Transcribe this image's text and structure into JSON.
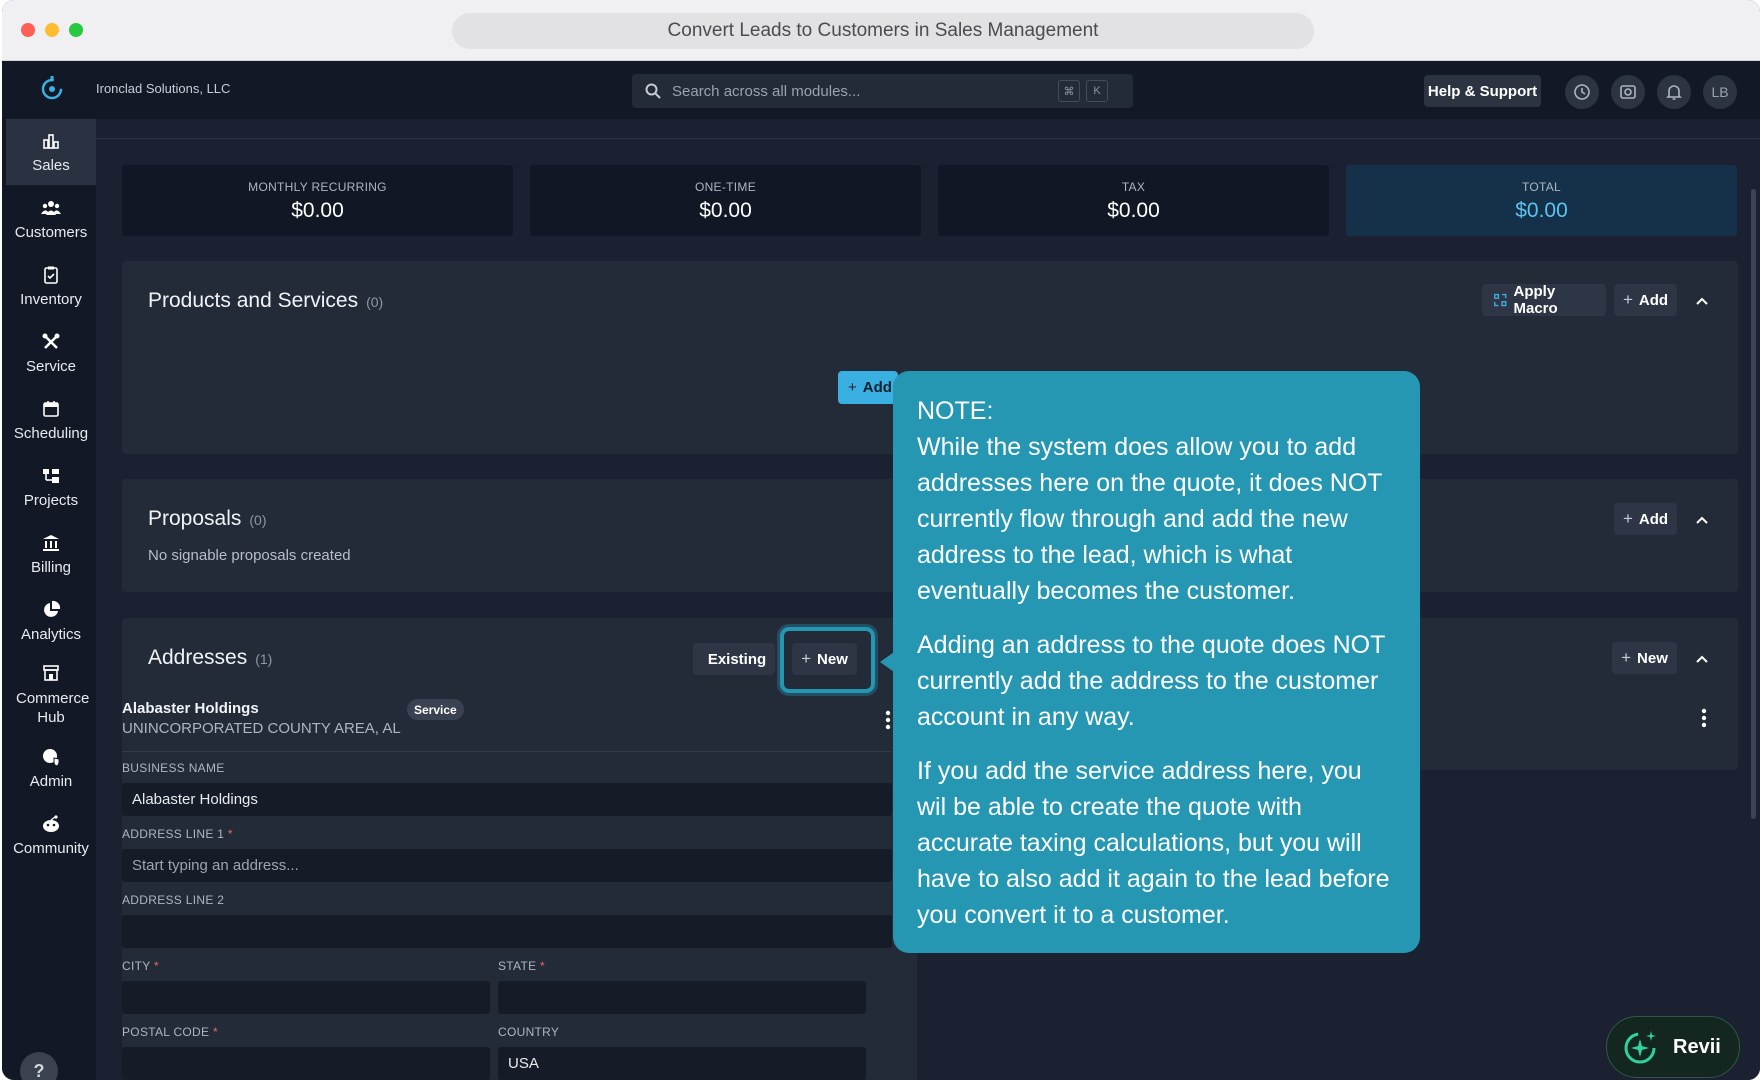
{
  "window": {
    "title": "Convert Leads to Customers in Sales Management"
  },
  "appbar": {
    "company": "Ironclad Solutions, LLC",
    "search_placeholder": "Search across all modules...",
    "kbd1": "⌘",
    "kbd2": "K",
    "help_label": "Help & Support",
    "avatar_initials": "LB"
  },
  "sidebar": {
    "items": [
      {
        "label": "Sales",
        "icon": "bar-chart-icon",
        "active": true
      },
      {
        "label": "Customers",
        "icon": "users-icon"
      },
      {
        "label": "Inventory",
        "icon": "clipboard-icon"
      },
      {
        "label": "Service",
        "icon": "tools-icon"
      },
      {
        "label": "Scheduling",
        "icon": "calendar-icon"
      },
      {
        "label": "Projects",
        "icon": "projects-icon"
      },
      {
        "label": "Billing",
        "icon": "bank-icon"
      },
      {
        "label": "Analytics",
        "icon": "pie-chart-icon"
      },
      {
        "label": "Commerce Hub",
        "icon": "store-icon"
      },
      {
        "label": "Admin",
        "icon": "admin-shield-icon"
      },
      {
        "label": "Community",
        "icon": "community-icon"
      }
    ],
    "help": "?"
  },
  "stats": [
    {
      "label": "MONTHLY RECURRING",
      "value": "$0.00"
    },
    {
      "label": "ONE-TIME",
      "value": "$0.00"
    },
    {
      "label": "TAX",
      "value": "$0.00"
    },
    {
      "label": "TOTAL",
      "value": "$0.00"
    }
  ],
  "products": {
    "title": "Products and Services",
    "count": "(0)",
    "apply_macro": "Apply Macro",
    "add": "Add",
    "center_add": "Add"
  },
  "proposals": {
    "title": "Proposals",
    "count": "(0)",
    "empty": "No signable proposals created",
    "add": "Add"
  },
  "addresses": {
    "title": "Addresses",
    "count": "(1)",
    "existing": "Existing",
    "new": "New",
    "right_new": "New",
    "entry": {
      "name": "Alabaster Holdings",
      "area": "UNINCORPORATED COUNTY AREA, AL",
      "badge": "Service"
    },
    "form": {
      "business_name_label": "BUSINESS NAME",
      "business_name_value": "Alabaster Holdings",
      "line1_label": "ADDRESS LINE 1",
      "line1_placeholder": "Start typing an address...",
      "line2_label": "ADDRESS LINE 2",
      "city_label": "CITY",
      "state_label": "STATE",
      "postal_label": "POSTAL CODE",
      "country_label": "COUNTRY",
      "country_value": "USA",
      "required_mark": "*"
    }
  },
  "note": {
    "heading": "NOTE:",
    "p1": "While the system does allow you to add addresses here on the quote, it does NOT currently flow through and add the new address to the lead, which is what eventually becomes the customer.",
    "p2": "Adding an address to the quote does NOT currently add the address to the customer account in any way.",
    "p3": "If you add the service address here, you wil be able to create the quote with accurate taxing calculations, but you will have to also add it again to the lead before you convert it to a customer."
  },
  "assistant": {
    "label": "Revii"
  },
  "colors": {
    "accent": "#3ab0e2",
    "note_bg": "#2597b3",
    "total_value": "#5cc3ee",
    "bg": "#1b2130",
    "sidebar_bg": "#121826"
  }
}
